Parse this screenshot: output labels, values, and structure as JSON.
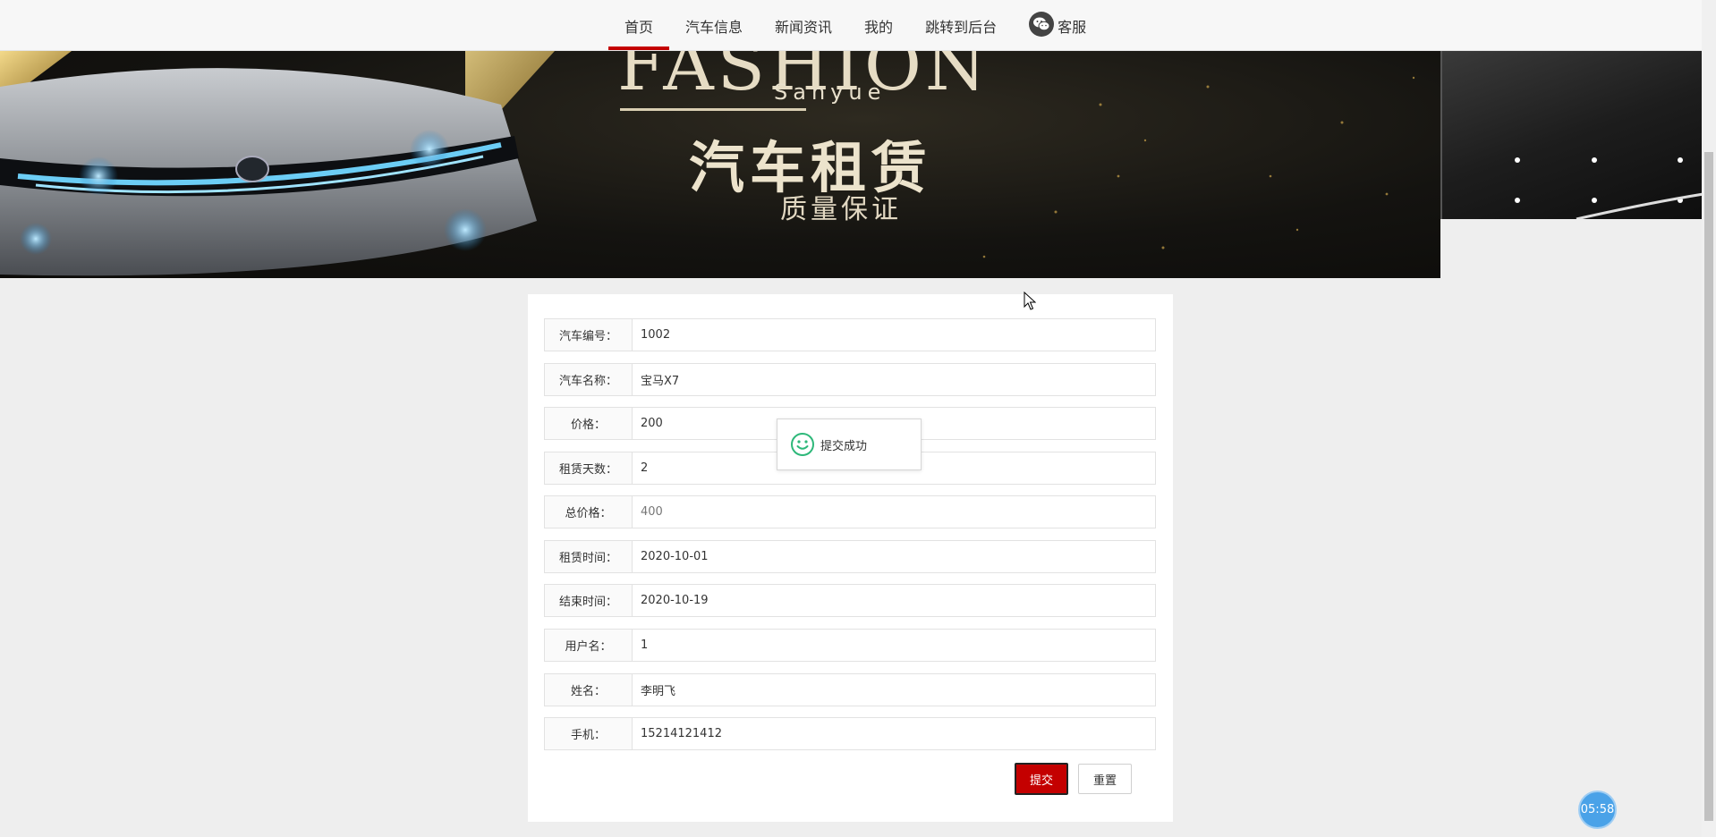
{
  "nav": {
    "items": [
      {
        "label": "首页",
        "active": true
      },
      {
        "label": "汽车信息"
      },
      {
        "label": "新闻资讯"
      },
      {
        "label": "我的"
      },
      {
        "label": "跳转到后台"
      },
      {
        "label": "客服",
        "icon": "wechat-icon"
      }
    ]
  },
  "banner": {
    "headline": "FASHION",
    "brand": "Sanyue",
    "title": "汽车租赁",
    "subtitle": "质量保证"
  },
  "form": {
    "fields": [
      {
        "label": "汽车编号：",
        "value": "1002"
      },
      {
        "label": "汽车名称：",
        "value": "宝马X7"
      },
      {
        "label": "价格：",
        "value": "200"
      },
      {
        "label": "租赁天数：",
        "value": "2"
      },
      {
        "label": "总价格：",
        "value": "400",
        "readonly": true
      },
      {
        "label": "租赁时间：",
        "value": "2020-10-01"
      },
      {
        "label": "结束时间：",
        "value": "2020-10-19"
      },
      {
        "label": "用户名：",
        "value": "1"
      },
      {
        "label": "姓名：",
        "value": "李明飞"
      },
      {
        "label": "手机：",
        "value": "15214121412"
      }
    ],
    "submit_label": "提交",
    "reset_label": "重置"
  },
  "toast": {
    "message": "提交成功",
    "icon": "smiley-icon"
  },
  "timer": {
    "label": "05:58"
  },
  "colors": {
    "accent": "#c40000",
    "timer": "#4aa2e8",
    "toast_icon": "#2eb87a"
  }
}
